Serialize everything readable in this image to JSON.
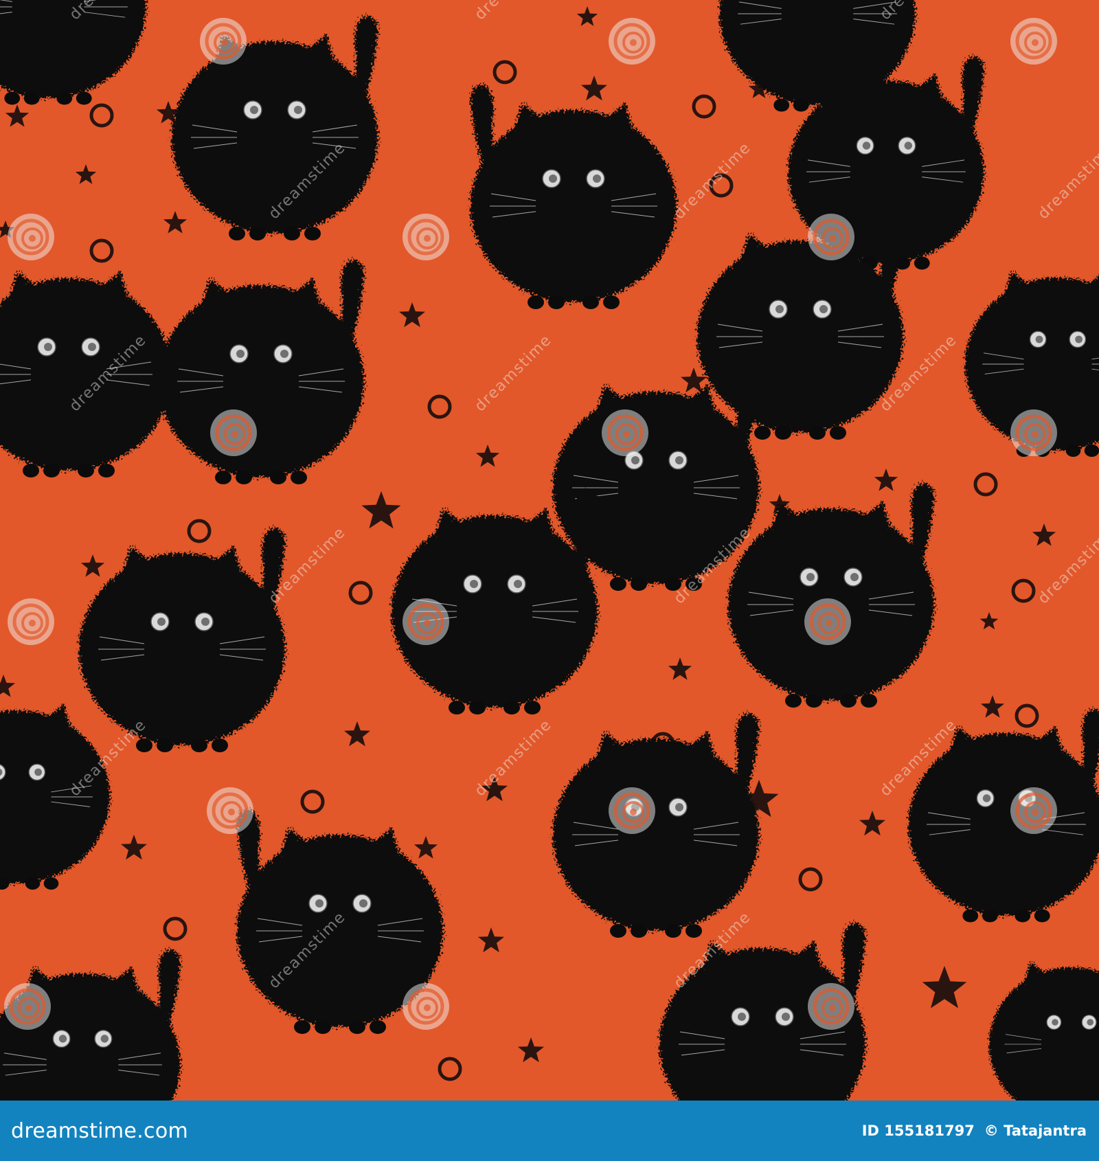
{
  "image": {
    "subject": "seamless pattern of round fluffy black cats with raised tails, stars and rings",
    "colors": {
      "background": "#e2582a",
      "cat": "#0b0b0b",
      "decoration": "#2a1410",
      "eye": "#d9d9d9",
      "footer": "#1383bf",
      "watermark": "#f2f2f2"
    }
  },
  "watermark": {
    "text": "dreamstime"
  },
  "footer": {
    "site": "dreamstime.com",
    "id_label": "ID 155181797",
    "copyright": "© Tatajantra"
  }
}
